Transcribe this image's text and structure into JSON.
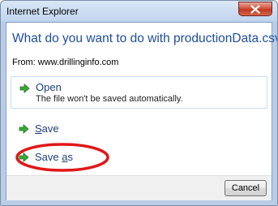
{
  "window": {
    "title": "Internet Explorer"
  },
  "dialog": {
    "question": "What do you want to do with productionData.csv?",
    "from": "From: www.drillinginfo.com",
    "options": [
      {
        "label": "Open",
        "sublabel": "The file won't be saved automatically.",
        "icon": "green-arrow-icon",
        "highlighted": true
      },
      {
        "label_pre": "",
        "label_u": "S",
        "label_post": "ave",
        "icon": "green-arrow-icon"
      },
      {
        "label_pre": "Save ",
        "label_u": "a",
        "label_post": "s",
        "icon": "green-arrow-icon"
      }
    ],
    "cancel_label": "Cancel"
  },
  "annotation": {
    "type": "red-ellipse",
    "target": "Save as",
    "color": "#e01818"
  },
  "colors": {
    "question_text": "#1e4e9a",
    "option_text": "#1e3f7a",
    "arrow_green": "#3aa838",
    "close_red": "#c8432b"
  }
}
